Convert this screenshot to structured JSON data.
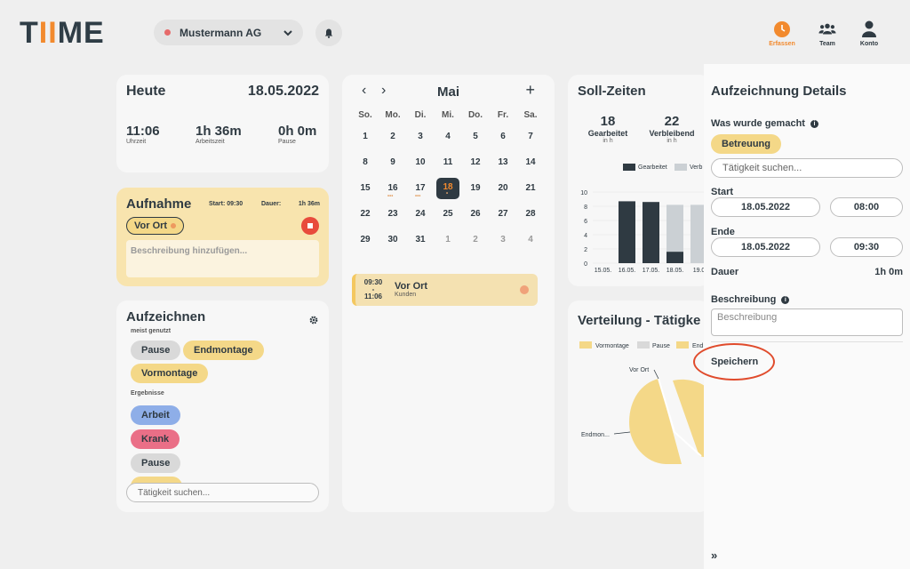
{
  "brand": {
    "logo_pre": "T",
    "logo_ii": "II",
    "logo_post": "ME",
    "accent": "#f28a2e"
  },
  "header": {
    "company": "Mustermann AG",
    "nav": [
      {
        "label": "Erfassen",
        "icon": "clock-icon",
        "active": true
      },
      {
        "label": "Team",
        "icon": "team-icon",
        "active": false
      },
      {
        "label": "Konto",
        "icon": "user-icon",
        "active": false
      }
    ]
  },
  "heute": {
    "title": "Heute",
    "date": "18.05.2022",
    "stats": [
      {
        "value": "11:06",
        "label": "Uhrzeit"
      },
      {
        "value": "1h 36m",
        "label": "Arbeitszeit"
      },
      {
        "value": "0h 0m",
        "label": "Pause"
      }
    ]
  },
  "aufnahme": {
    "title": "Aufnahme",
    "start": "Start: 09:30",
    "dauer_label": "Dauer:",
    "dauer_value": "1h 36m",
    "activity": "Vor Ort",
    "placeholder": "Beschreibung hinzufügen..."
  },
  "aufzeichnen": {
    "title": "Aufzeichnen",
    "meist_label": "meist genutzt",
    "meist": [
      "Pause",
      "Endmontage",
      "Vormontage"
    ],
    "ergebnisse_label": "Ergebnisse",
    "ergebnisse": [
      "Arbeit",
      "Krank",
      "Pause"
    ],
    "search_placeholder": "Tätigkeit suchen..."
  },
  "calendar": {
    "month": "Mai",
    "prev": "‹",
    "next": "›",
    "add": "+",
    "weekdays": [
      "So.",
      "Mo.",
      "Di.",
      "Mi.",
      "Do.",
      "Fr.",
      "Sa."
    ],
    "weeks": [
      [
        "1",
        "2",
        "3",
        "4",
        "5",
        "6",
        "7"
      ],
      [
        "8",
        "9",
        "10",
        "11",
        "12",
        "13",
        "14"
      ],
      [
        "15",
        "16",
        "17",
        "18",
        "19",
        "20",
        "21"
      ],
      [
        "22",
        "23",
        "24",
        "25",
        "26",
        "27",
        "28"
      ],
      [
        "29",
        "30",
        "31",
        "1",
        "2",
        "3",
        "4"
      ]
    ],
    "event": {
      "time_start": "09:30",
      "dash": "-",
      "time_end": "11:06",
      "name": "Vor Ort",
      "category": "Kunden"
    }
  },
  "soll": {
    "title": "Soll-Zeiten",
    "gearbeitet": {
      "value": "18",
      "label": "Gearbeitet",
      "unit": "in h"
    },
    "verbleibend": {
      "value": "22",
      "label": "Verbleibend",
      "unit": "in h"
    },
    "chart_data": {
      "type": "bar",
      "categories": [
        "15.05.",
        "16.05.",
        "17.05.",
        "18.05.",
        "19.0"
      ],
      "series": [
        {
          "name": "Gearbeitet",
          "values": [
            0,
            8.7,
            8.6,
            1.6,
            0
          ],
          "color": "#2f3a42"
        },
        {
          "name": "Verb",
          "values": [
            0,
            0,
            0,
            8.2,
            8.2
          ],
          "color": "#cbd0d4"
        }
      ],
      "yticks": [
        "10",
        "8",
        "6",
        "4",
        "2",
        "0"
      ],
      "ylim": [
        0,
        10
      ]
    }
  },
  "verteilung": {
    "title": "Verteilung - Tätigke",
    "legend": [
      {
        "name": "Vormontage",
        "color": "#f4d888"
      },
      {
        "name": "Pause",
        "color": "#d9d9d9"
      },
      {
        "name": "End",
        "color": "#f4d888"
      }
    ],
    "labels": [
      "Vor Ort",
      "Endmon..."
    ]
  },
  "panel": {
    "title": "Aufzeichnung Details",
    "was_label": "Was wurde gemacht",
    "activity": "Betreuung",
    "search_placeholder": "Tätigkeit suchen...",
    "start_label": "Start",
    "start_date": "18.05.2022",
    "start_time": "08:00",
    "ende_label": "Ende",
    "end_date": "18.05.2022",
    "end_time": "09:30",
    "dauer_label": "Dauer",
    "dauer_value": "1h 0m",
    "beschreibung_label": "Beschreibung",
    "beschreibung_placeholder": "Beschreibung",
    "save": "Speichern",
    "collapse": "»"
  }
}
